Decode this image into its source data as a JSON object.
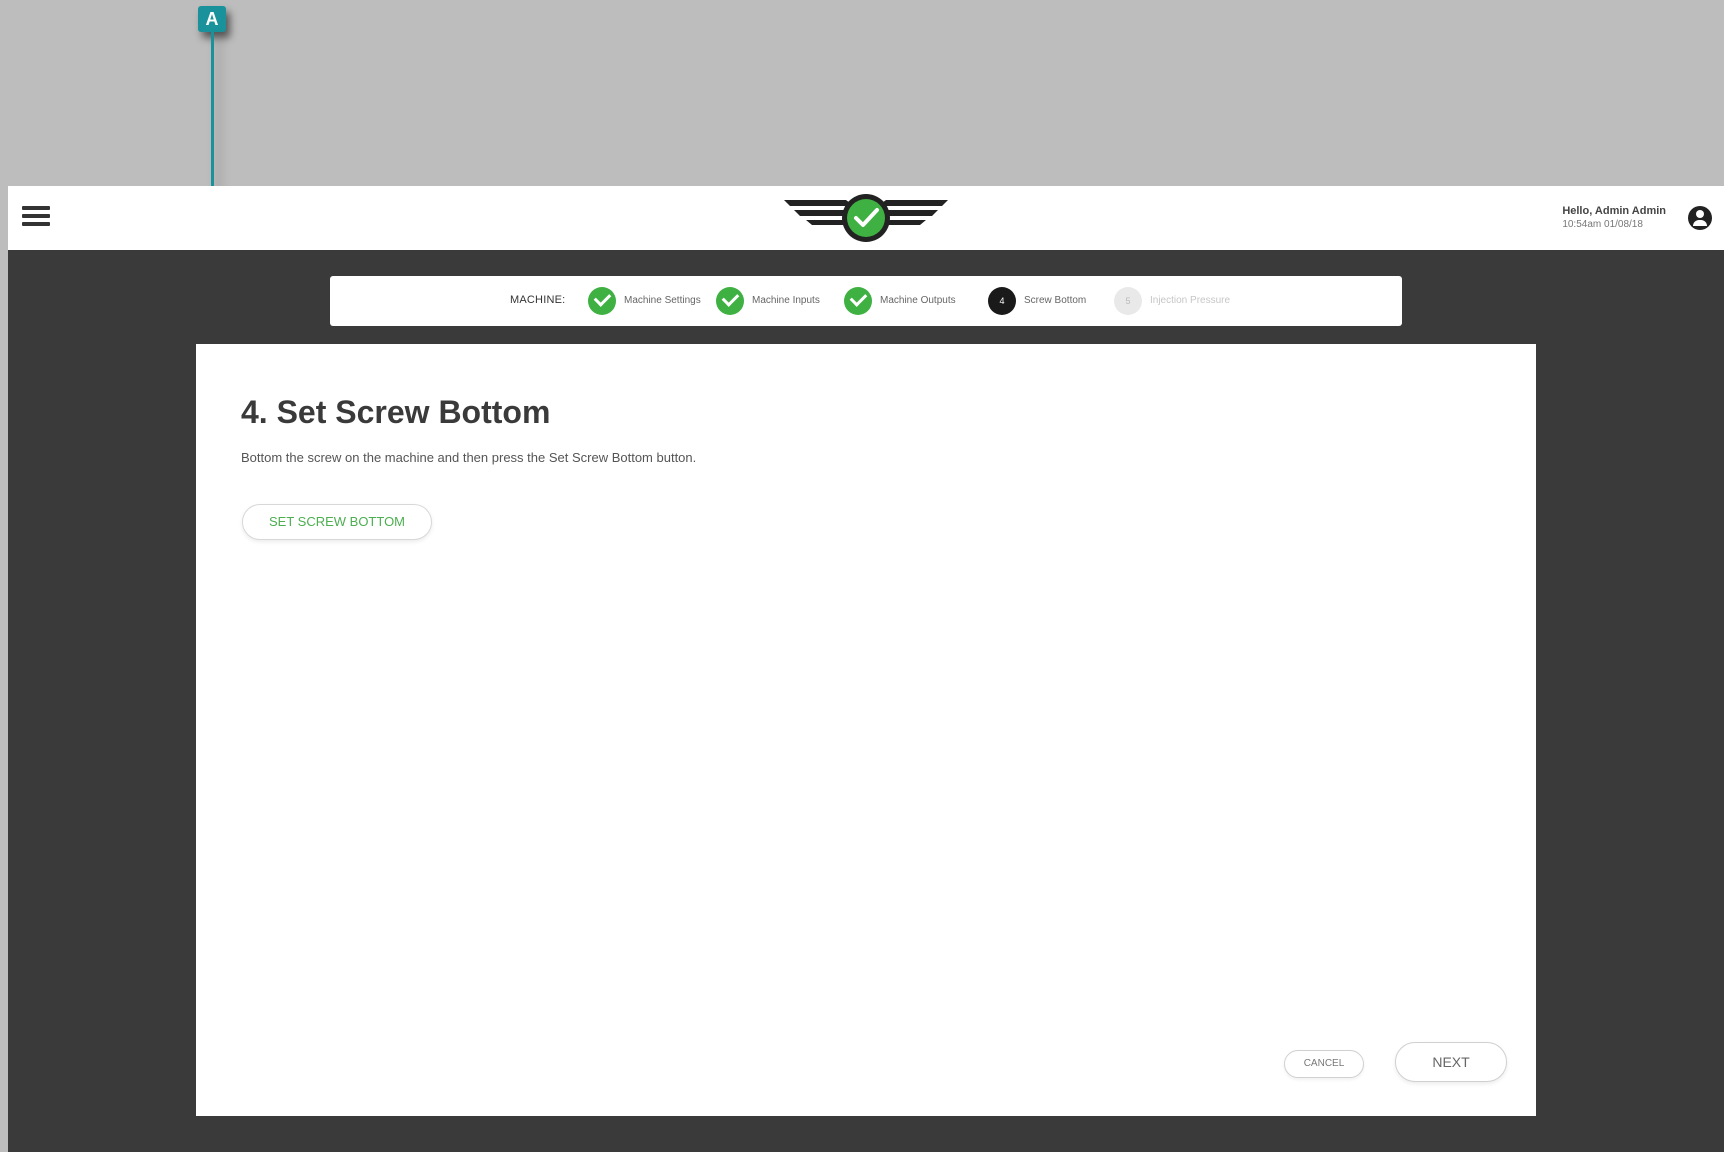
{
  "callout": {
    "label": "A"
  },
  "topbar": {
    "user_greeting": "Hello, Admin Admin",
    "user_datetime": "10:54am 01/08/18"
  },
  "stepper": {
    "machine_label": "MACHINE:",
    "steps": [
      {
        "label": "Machine Settings",
        "status": "done"
      },
      {
        "label": "Machine Inputs",
        "status": "done"
      },
      {
        "label": "Machine Outputs",
        "status": "done"
      },
      {
        "label": "Screw Bottom",
        "status": "current",
        "number": "4"
      },
      {
        "label": "Injection Pressure",
        "status": "pending",
        "number": "5"
      }
    ]
  },
  "card": {
    "title": "4. Set Screw Bottom",
    "description": "Bottom the screw on the machine and then press the Set Screw Bottom button.",
    "set_button_label": "SET SCREW BOTTOM",
    "cancel_label": "CANCEL",
    "next_label": "NEXT"
  },
  "colors": {
    "accent_green": "#3fb042",
    "callout_teal": "#19929b",
    "app_background": "#3a3a3a",
    "outer_background": "#bdbdbd"
  },
  "icons": [
    "menu-icon",
    "logo-wings-check",
    "check-icon",
    "user-account-icon"
  ]
}
